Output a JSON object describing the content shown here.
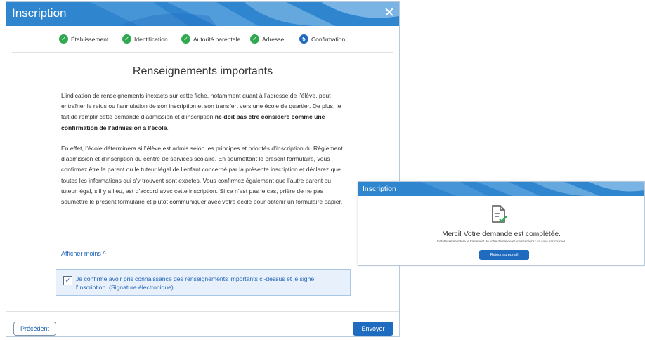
{
  "dialog": {
    "title": "Inscription",
    "close_glyph": "✕",
    "steps": [
      {
        "label": "Établissement",
        "state": "done",
        "marker": "✓"
      },
      {
        "label": "Identification",
        "state": "done",
        "marker": "✓"
      },
      {
        "label": "Autorité parentale",
        "state": "done",
        "marker": "✓"
      },
      {
        "label": "Adresse",
        "state": "done",
        "marker": "✓"
      },
      {
        "label": "Confirmation",
        "state": "current",
        "marker": "5"
      }
    ],
    "heading": "Renseignements importants",
    "paragraph1_plain": "L’indication de renseignements inexacts sur cette fiche, notamment quant à l’adresse de l’élève, peut entraîner le refus ou l’annulation de son inscription et son transfert vers une école de quartier. De plus, le fait de remplir cette demande d’admission et d’inscription ",
    "paragraph1_bold": "ne doit pas être considéré comme une confirmation de l’admission à l’école",
    "paragraph1_end": ".",
    "paragraph2": "En effet, l’école déterminera si l’élève est admis selon les principes et priorités d’inscription du Règlement d’admission et d’inscription du centre de services scolaire. En soumettant le présent formulaire, vous confirmez être le parent ou le tuteur légal de l’enfant concerné par la présente inscription et déclarez que toutes les informations qui s’y trouvent sont exactes. Vous confirmez également que l’autre parent ou tuteur légal, s’il y a lieu, est d’accord avec cette inscription. Si ce n’est pas le cas, prière de ne pas soumettre le présent formulaire et plutôt communiquer avec votre école pour obtenir un formulaire papier.",
    "show_less": "Afficher moins ^",
    "confirm_checked": "✓",
    "confirm_text": "Je confirme avoir pris connaissance des renseignements importants ci-dessus et je signe l'inscription. (Signature électronique)",
    "prev_button": "Précédent",
    "send_button": "Envoyer"
  },
  "success_dialog": {
    "title": "Inscription",
    "message": "Merci! Votre demande est complétée.",
    "sub_message": "L’établissement fera le traitement de votre demande et vous recevrez un suivi par courriel.",
    "return_button": "Retour au portail"
  },
  "colors": {
    "title_bar": "#2f86cf",
    "primary_button": "#1f6bbf",
    "step_done": "#2fa84f",
    "link": "#1e63b5"
  }
}
